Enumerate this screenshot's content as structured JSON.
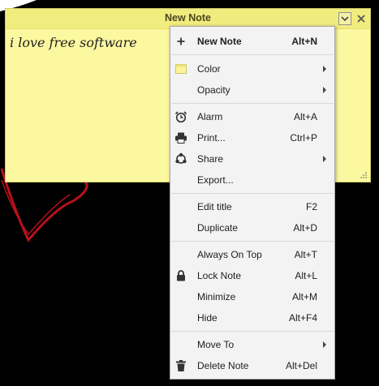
{
  "note": {
    "title": "New Note",
    "body": "i love free software"
  },
  "menu": {
    "items": [
      {
        "label": "New Note",
        "shortcut": "Alt+N",
        "icon": "plus-icon"
      },
      {
        "label": "Color",
        "icon": "color-swatch-icon",
        "submenu": true
      },
      {
        "label": "Opacity",
        "submenu": true
      },
      {
        "label": "Alarm",
        "shortcut": "Alt+A",
        "icon": "alarm-clock-icon"
      },
      {
        "label": "Print...",
        "shortcut": "Ctrl+P",
        "icon": "printer-icon"
      },
      {
        "label": "Share",
        "icon": "share-icon",
        "submenu": true
      },
      {
        "label": "Export..."
      },
      {
        "label": "Edit title",
        "shortcut": "F2"
      },
      {
        "label": "Duplicate",
        "shortcut": "Alt+D"
      },
      {
        "label": "Always On Top",
        "shortcut": "Alt+T"
      },
      {
        "label": "Lock Note",
        "shortcut": "Alt+L",
        "icon": "lock-icon"
      },
      {
        "label": "Minimize",
        "shortcut": "Alt+M"
      },
      {
        "label": "Hide",
        "shortcut": "Alt+F4"
      },
      {
        "label": "Move To",
        "submenu": true
      },
      {
        "label": "Delete Note",
        "shortcut": "Alt+Del",
        "icon": "trash-icon"
      }
    ]
  },
  "colors": {
    "note_background": "#fcf8a0",
    "title_bar": "#f1ec7e",
    "menu_background": "#f3f3f3",
    "wallpaper": "#000000"
  }
}
